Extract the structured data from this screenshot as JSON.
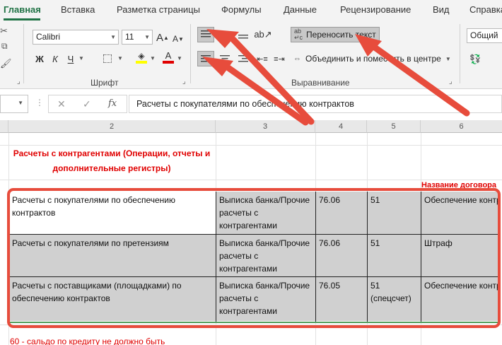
{
  "tabs": [
    "Главная",
    "Вставка",
    "Разметка страницы",
    "Формулы",
    "Данные",
    "Рецензирование",
    "Вид",
    "Справка"
  ],
  "font": {
    "group_label": "Шрифт",
    "font_name": "Calibri",
    "font_size": "11",
    "bold": "Ж",
    "italic": "К",
    "underline": "Ч",
    "grow": "A",
    "shrink": "A"
  },
  "alignment": {
    "group_label": "Выравнивание",
    "wrap_text": "Переносить текст",
    "merge_center": "Объединить и поместить в центре"
  },
  "number": {
    "format": "Общий"
  },
  "formula_bar": {
    "content": "Расчеты с покупателями по обеспечению контрактов",
    "fx": "fx",
    "cancel": "✕",
    "enter": "✓"
  },
  "columns": [
    "2",
    "3",
    "4",
    "5",
    "6"
  ],
  "sheet": {
    "title": "Расчеты с контрагентами (Операции, отчеты и дополнительные регистры)",
    "contract_header": "Название договора",
    "rows": [
      {
        "c2": "Расчеты с покупателями по обеспечению контрактов",
        "c3": "Выписка банка/Прочие расчеты с контрагентами",
        "c4": "76.06",
        "c5": "51",
        "c6": "Обеспечение контракта"
      },
      {
        "c2": "Расчеты с покупателями по претензиям",
        "c3": "Выписка банка/Прочие расчеты с контрагентами",
        "c4": "76.06",
        "c5": "51",
        "c6": "Штраф"
      },
      {
        "c2": "Расчеты с поставщиками (площадками)  по обеспечению контрактов",
        "c3": "Выписка банка/Прочие расчеты с контрагентами",
        "c4": "76.05",
        "c5": "51 (спецсчет)",
        "c6": "Обеспечение контракта"
      }
    ],
    "note": "60 - сальдо по кредиту не должно быть"
  },
  "colors": {
    "excel_green": "#217346",
    "annotation_red": "#e74c3c",
    "cell_grey": "#d0d0d0",
    "title_red": "#e00000"
  }
}
